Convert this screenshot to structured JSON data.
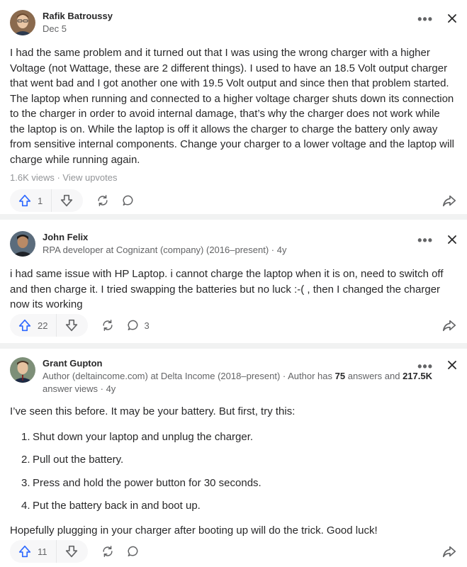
{
  "answers": [
    {
      "author": "Rafik Batroussy",
      "credential": "Dec 5",
      "paragraphs": [
        "I had the same problem and it turned out that I was using the wrong charger with a higher Voltage (not Wattage, these are 2 different things). I used to have an 18.5 Volt output charger that went bad and I got another one with 19.5 Volt output and since then that problem started. The laptop when running and connected to a higher voltage charger shuts down its connection to the charger in order to avoid internal damage, that’s why the charger does not work while the laptop is on. While the laptop is off it allows the charger to charge the battery only away from sensitive internal components. Change your charger to a lower voltage and the laptop will charge while running again."
      ],
      "views": "1.6K views · View upvotes",
      "upvotes": "1",
      "comments": ""
    },
    {
      "author": "John Felix",
      "credential": "RPA developer at Cognizant (company) (2016–present) · 4y",
      "paragraphs": [
        "i had same issue with HP Laptop. i cannot charge the laptop when it is on, need to switch off and then charge it. I tried swapping the batteries but no luck :-( , then I changed the charger now its working"
      ],
      "upvotes": "22",
      "comments": "3"
    },
    {
      "author": "Grant Gupton",
      "credential_prefix": "Author (deltaincome.com) at Delta Income (2018–present) · Author has",
      "credential_answers": "75",
      "credential_mid": "answers and",
      "credential_views": "217.5K",
      "credential_suffix": "answer views · 4y",
      "intro": "I’ve seen this before. It may be your battery. But first, try this:",
      "steps": [
        {
          "num": "1.",
          "text": "Shut down your laptop and unplug the charger."
        },
        {
          "num": "2.",
          "text": "Pull out the battery."
        },
        {
          "num": "3.",
          "text": "Press and hold the power button for 30 seconds."
        },
        {
          "num": "4.",
          "text": "Put the battery back in and boot up."
        }
      ],
      "outro": "Hopefully plugging in your charger after booting up will do the trick. Good luck!",
      "upvotes": "11",
      "comments": ""
    }
  ],
  "menu_label": "•••",
  "colors": {
    "upvote": "#2e69ff",
    "text": "#282829",
    "muted": "#636466",
    "separator": "#f1f2f2"
  },
  "icons": [
    "upvote-icon",
    "downvote-icon",
    "reshare-icon",
    "comment-icon",
    "share-icon",
    "more-icon",
    "close-icon"
  ]
}
